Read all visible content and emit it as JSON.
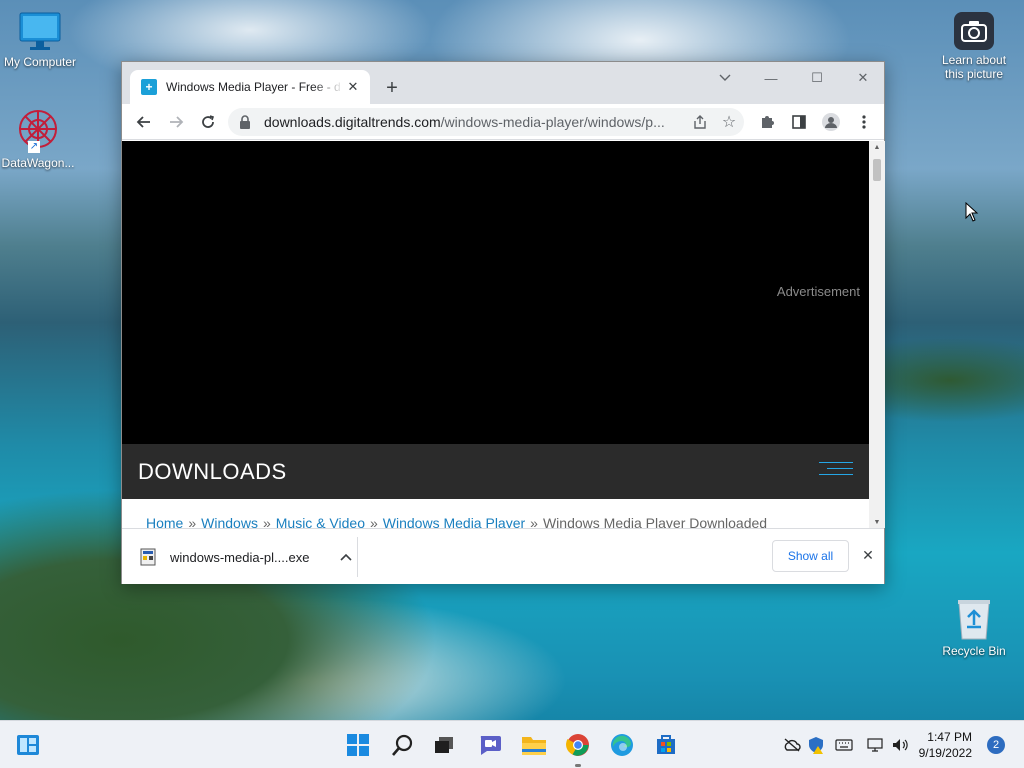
{
  "desktop": {
    "icons": [
      {
        "label": "My Computer",
        "icon": "monitor-icon"
      },
      {
        "label": "DataWagon...",
        "icon": "datawagon-icon"
      },
      {
        "label": "Learn about this picture",
        "icon": "camera-icon"
      },
      {
        "label": "Recycle Bin",
        "icon": "recycle-bin-icon"
      }
    ]
  },
  "browser": {
    "tab": {
      "title": "Windows Media Player - Free - d",
      "favicon": "digitaltrends-icon"
    },
    "url_host": "downloads.digitaltrends.com",
    "url_path": "/windows-media-player/windows/p...",
    "window_controls": {
      "minimize": "—",
      "maximize": "☐",
      "close": "✕"
    }
  },
  "page": {
    "ad_label": "Advertisement",
    "section_heading": "DOWNLOADS",
    "breadcrumbs": [
      "Home",
      "Windows",
      "Music & Video",
      "Windows Media Player"
    ],
    "breadcrumb_current": "Windows Media Player Downloaded",
    "breadcrumb_separator": "»"
  },
  "download_shelf": {
    "filename": "windows-media-pl....exe",
    "show_all_label": "Show all"
  },
  "taskbar": {
    "apps": [
      "start-icon",
      "search-icon",
      "task-view-icon",
      "teams-chat-icon",
      "file-explorer-icon",
      "chrome-icon",
      "edge-icon",
      "store-icon"
    ],
    "time": "1:47 PM",
    "date": "9/19/2022",
    "notification_count": "2"
  },
  "colors": {
    "accent_blue": "#1a73e8",
    "link_blue": "#1a7fbf",
    "downloads_bar": "#2b2b2b",
    "menu_lines": "#25a6e6"
  }
}
